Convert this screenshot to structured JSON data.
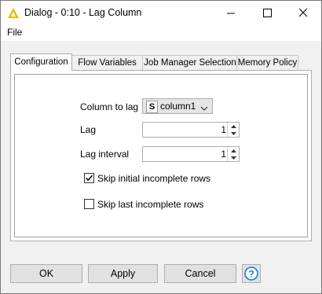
{
  "window": {
    "title": "Dialog - 0:10 - Lag Column",
    "accent_color": "#f2b705"
  },
  "menu": {
    "file": "File"
  },
  "tabs": [
    {
      "label": "Configuration",
      "active": true
    },
    {
      "label": "Flow Variables",
      "active": false
    },
    {
      "label": "Job Manager Selection",
      "active": false
    },
    {
      "label": "Memory Policy",
      "active": false
    }
  ],
  "form": {
    "column_label": "Column to lag",
    "column_type": "S",
    "column_value": "column1",
    "lag_label": "Lag",
    "lag_value": "1",
    "lag_interval_label": "Lag interval",
    "lag_interval_value": "1",
    "skip_initial_label": "Skip initial incomplete rows",
    "skip_initial_checked": true,
    "skip_last_label": "Skip last incomplete rows",
    "skip_last_checked": false
  },
  "buttons": {
    "ok": "OK",
    "apply": "Apply",
    "cancel": "Cancel",
    "help_icon": "help-icon"
  }
}
